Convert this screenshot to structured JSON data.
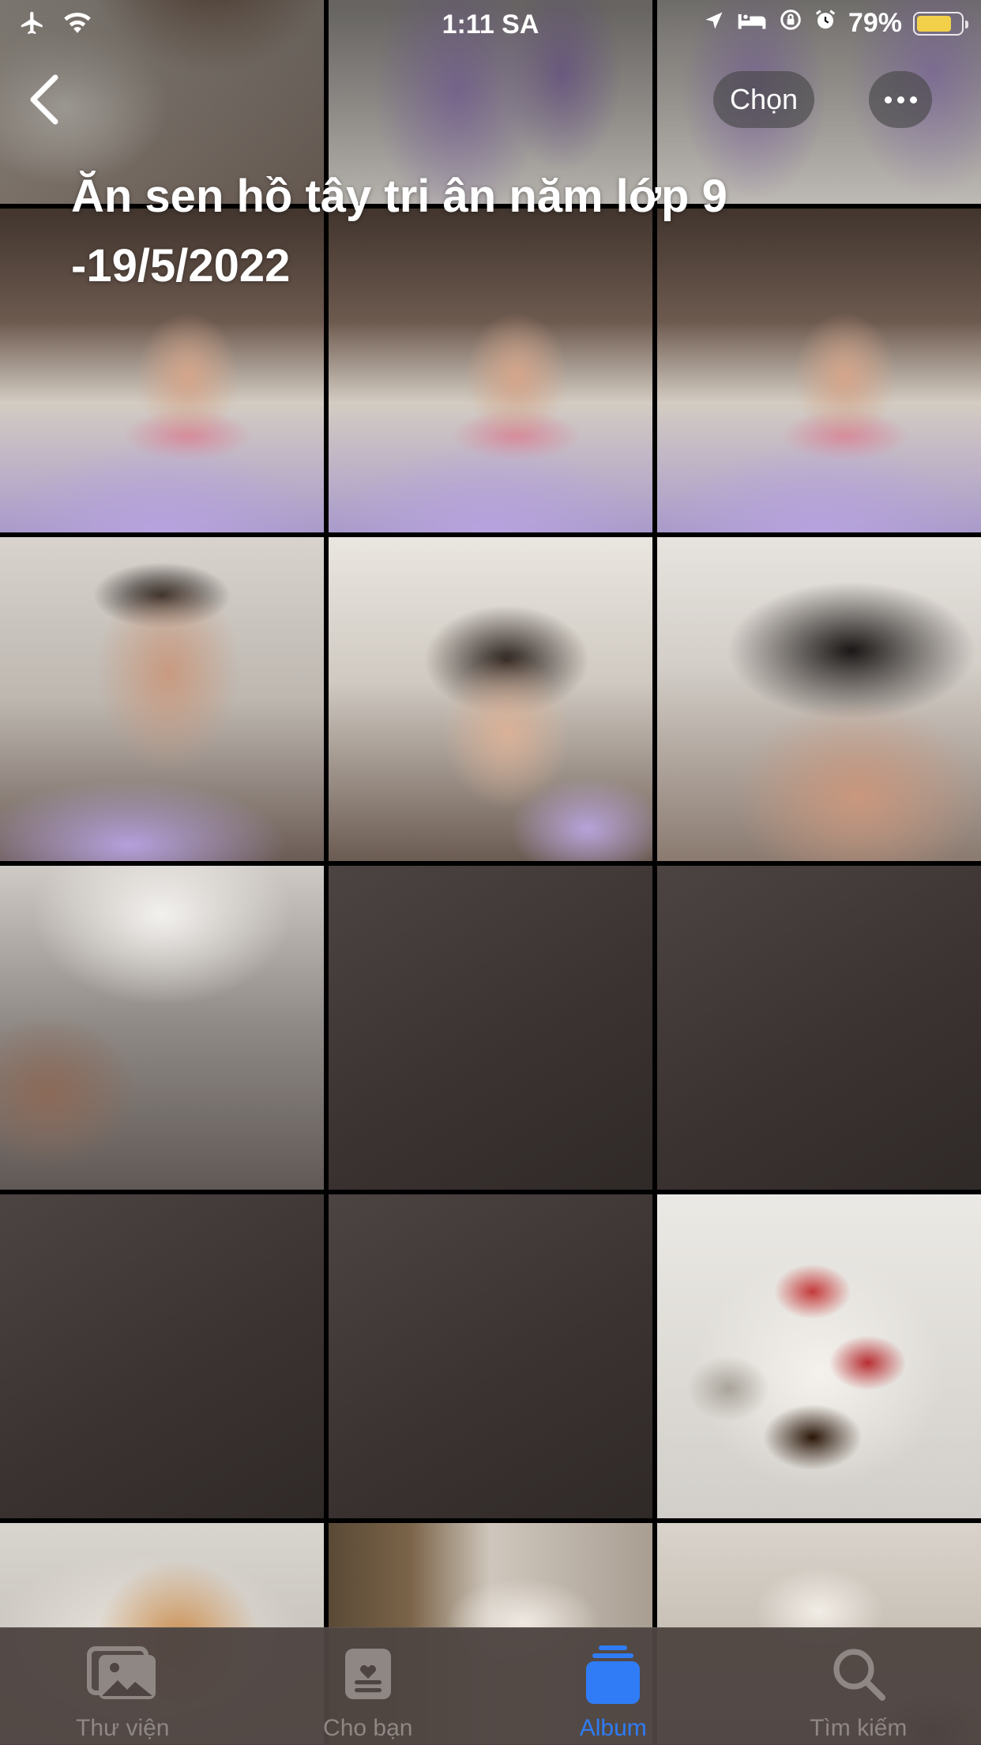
{
  "status_bar": {
    "time": "1:11 SA",
    "battery_percent": "79%",
    "battery_level": 0.79,
    "icons": [
      "airplane-icon",
      "wifi-icon",
      "location-icon",
      "bed-icon",
      "rotation-lock-icon",
      "alarm-icon",
      "battery-icon"
    ]
  },
  "nav": {
    "back_icon": "chevron-left-icon",
    "select_label": "Chọn",
    "more_icon": "ellipsis-icon"
  },
  "album": {
    "title": "Ăn sen hồ tây tri ân năm lớp 9 -19/5/2022"
  },
  "tabs": [
    {
      "label": "Thư viện",
      "icon": "photo-library-icon",
      "active": false
    },
    {
      "label": "Cho bạn",
      "icon": "for-you-icon",
      "active": false
    },
    {
      "label": "Album",
      "icon": "album-stack-icon",
      "active": true
    },
    {
      "label": "Tìm kiếm",
      "icon": "search-icon",
      "active": false
    }
  ],
  "colors": {
    "accent": "#2f7cf6",
    "tab_inactive": "#8e8784",
    "tabbar_bg": "#4e4542",
    "battery_fill": "#f2d04a"
  }
}
